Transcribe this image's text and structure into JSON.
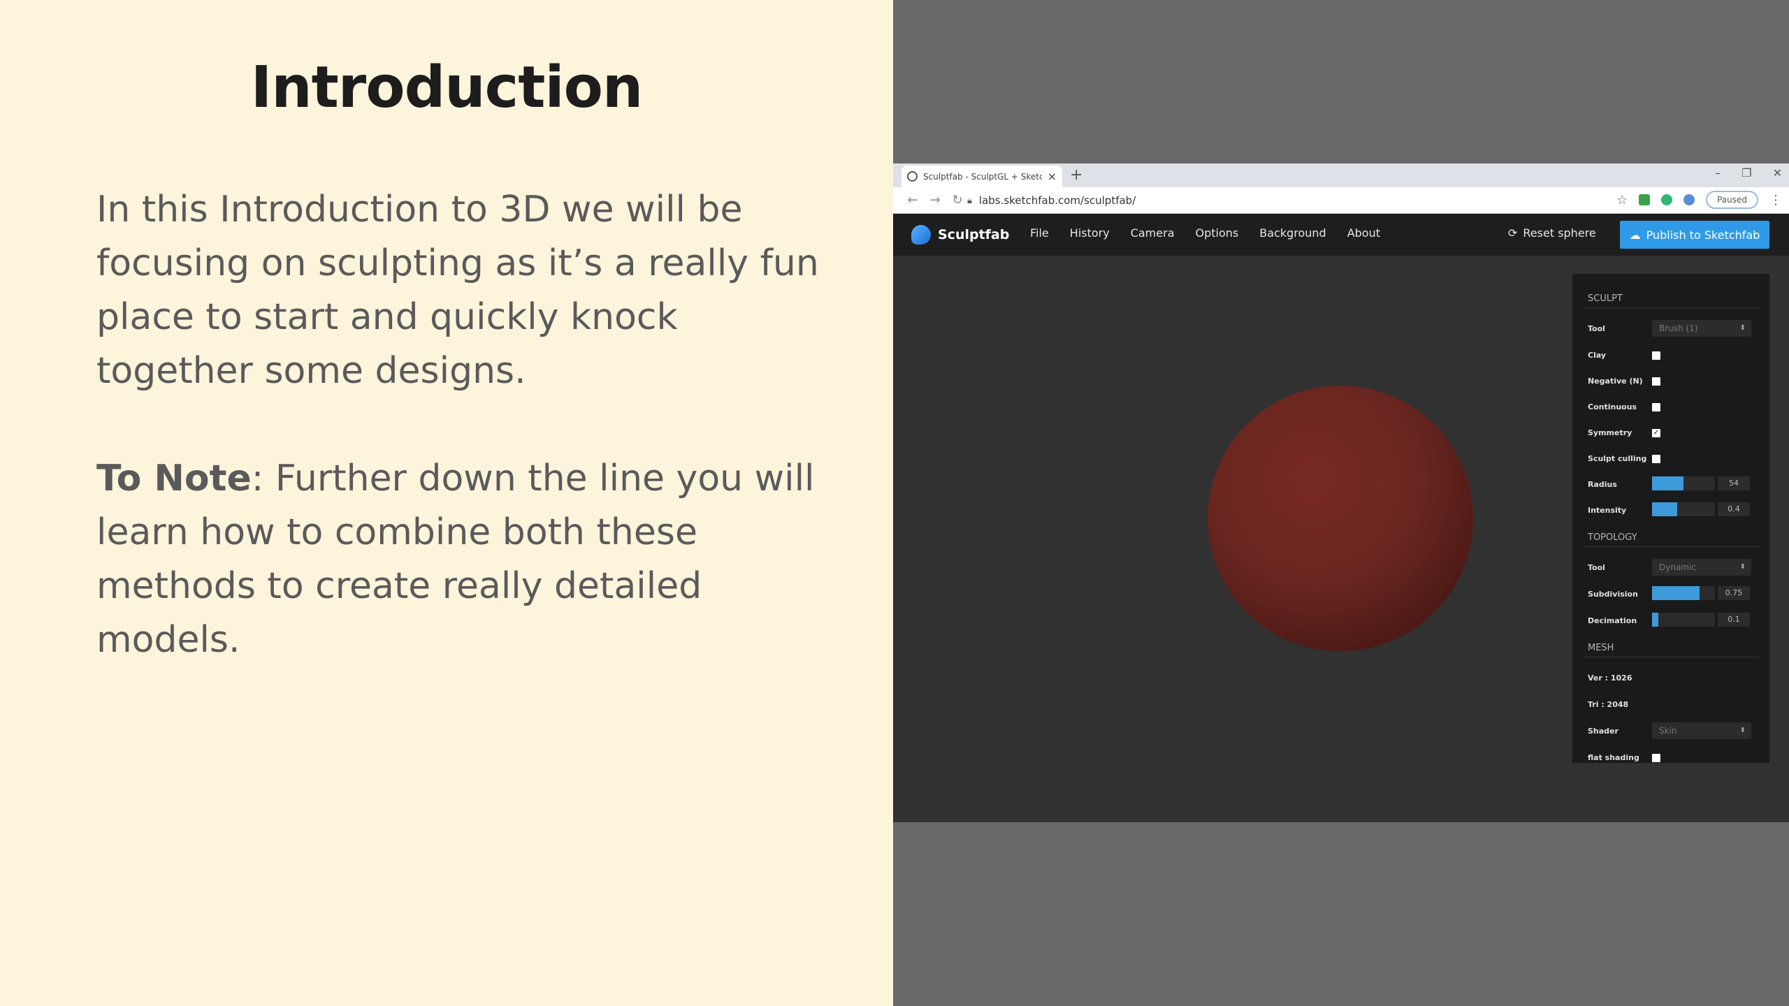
{
  "slide": {
    "title": "Introduction",
    "para1": "In this Introduction to 3D we will be focusing on sculpting as it’s a really fun place to start and quickly knock together some designs.",
    "para2_bold": "To Note",
    "para2_rest": ": Further down the line you will learn how to combine both these methods to create really detailed models."
  },
  "browser": {
    "tab_title": "Sculptfab - SculptGL + Sketchfab",
    "new_tab": "+",
    "url": "labs.sketchfab.com/sculptfab/",
    "profile_label": "Paused"
  },
  "app": {
    "logo": "Sculptfab",
    "menu": [
      "File",
      "History",
      "Camera",
      "Options",
      "Background",
      "About"
    ],
    "reset_label": "Reset sphere",
    "publish_label": "Publish to Sketchfab",
    "colors": {
      "accent": "#2f9ae8",
      "sphere": "#692620"
    }
  },
  "gui": {
    "sculpt": {
      "title": "SCULPT",
      "tool_label": "Tool",
      "tool_value": "Brush (1)",
      "clay": "Clay",
      "negative": "Negative (N)",
      "continuous": "Continuous",
      "symmetry": "Symmetry",
      "sculpt_culling": "Sculpt culling",
      "radius_label": "Radius",
      "radius_value": "54",
      "radius_fraction": 0.5,
      "intensity_label": "Intensity",
      "intensity_value": "0.4",
      "intensity_fraction": 0.4
    },
    "topology": {
      "title": "TOPOLOGY",
      "tool_label": "Tool",
      "tool_value": "Dynamic",
      "subdivision_label": "Subdivision",
      "subdivision_value": "0.75",
      "subdivision_fraction": 0.75,
      "decimation_label": "Decimation",
      "decimation_value": "0.1",
      "decimation_fraction": 0.1
    },
    "mesh": {
      "title": "MESH",
      "vertices": "Ver : 1026",
      "triangles": "Tri : 2048",
      "shader_label": "Shader",
      "shader_value": "Skin",
      "flat_shading": "flat shading"
    }
  }
}
